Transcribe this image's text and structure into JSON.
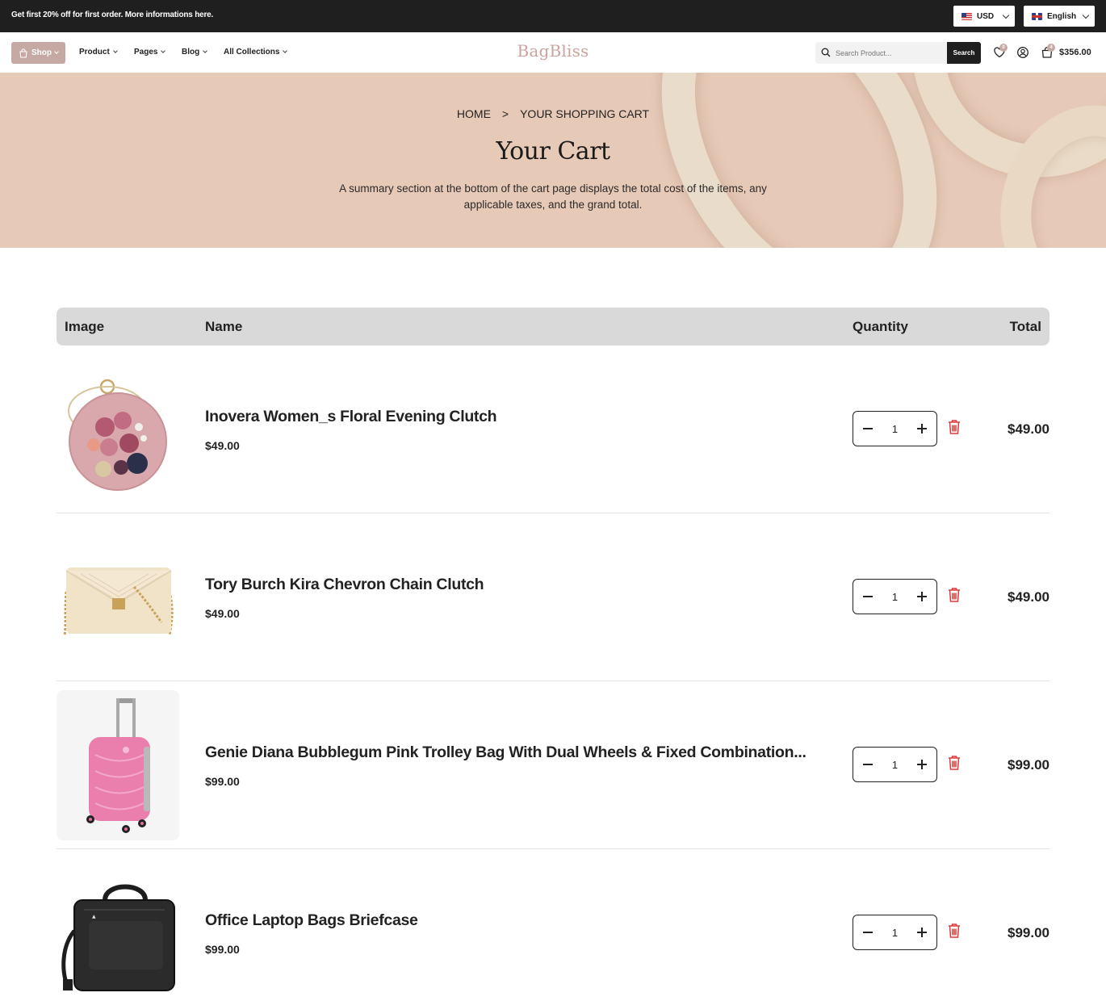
{
  "topbar": {
    "promo": "Get first 20% off for first order. More informations here.",
    "currency": "USD",
    "language": "English"
  },
  "nav": {
    "shop_label": "Shop",
    "items": [
      "Product",
      "Pages",
      "Blog",
      "All Collections"
    ],
    "logo": "BagBliss",
    "search_placeholder": "Search Product...",
    "search_button": "Search",
    "wishlist_count": "0",
    "cart_count": "4",
    "cart_total": "$356.00"
  },
  "hero": {
    "breadcrumb_home": "HOME",
    "breadcrumb_sep": ">",
    "breadcrumb_current": "YOUR SHOPPING CART",
    "title": "Your Cart",
    "description": "A summary section at the bottom of the cart page displays the total cost of the items, any applicable taxes, and the grand total."
  },
  "table": {
    "headers": {
      "image": "Image",
      "name": "Name",
      "quantity": "Quantity",
      "total": "Total"
    },
    "rows": [
      {
        "name": "Inovera Women_s Floral Evening Clutch",
        "price": "$49.00",
        "quantity": "1",
        "total": "$49.00"
      },
      {
        "name": "Tory Burch Kira Chevron Chain Clutch",
        "price": "$49.00",
        "quantity": "1",
        "total": "$49.00"
      },
      {
        "name": "Genie Diana Bubblegum Pink Trolley Bag With Dual Wheels & Fixed Combination...",
        "price": "$99.00",
        "quantity": "1",
        "total": "$99.00"
      },
      {
        "name": "Office Laptop Bags Briefcase",
        "price": "$99.00",
        "quantity": "1",
        "total": "$99.00"
      }
    ]
  },
  "colors": {
    "accent": "#c7a9a3",
    "dark": "#1f1f1f",
    "danger": "#d93a3a"
  }
}
